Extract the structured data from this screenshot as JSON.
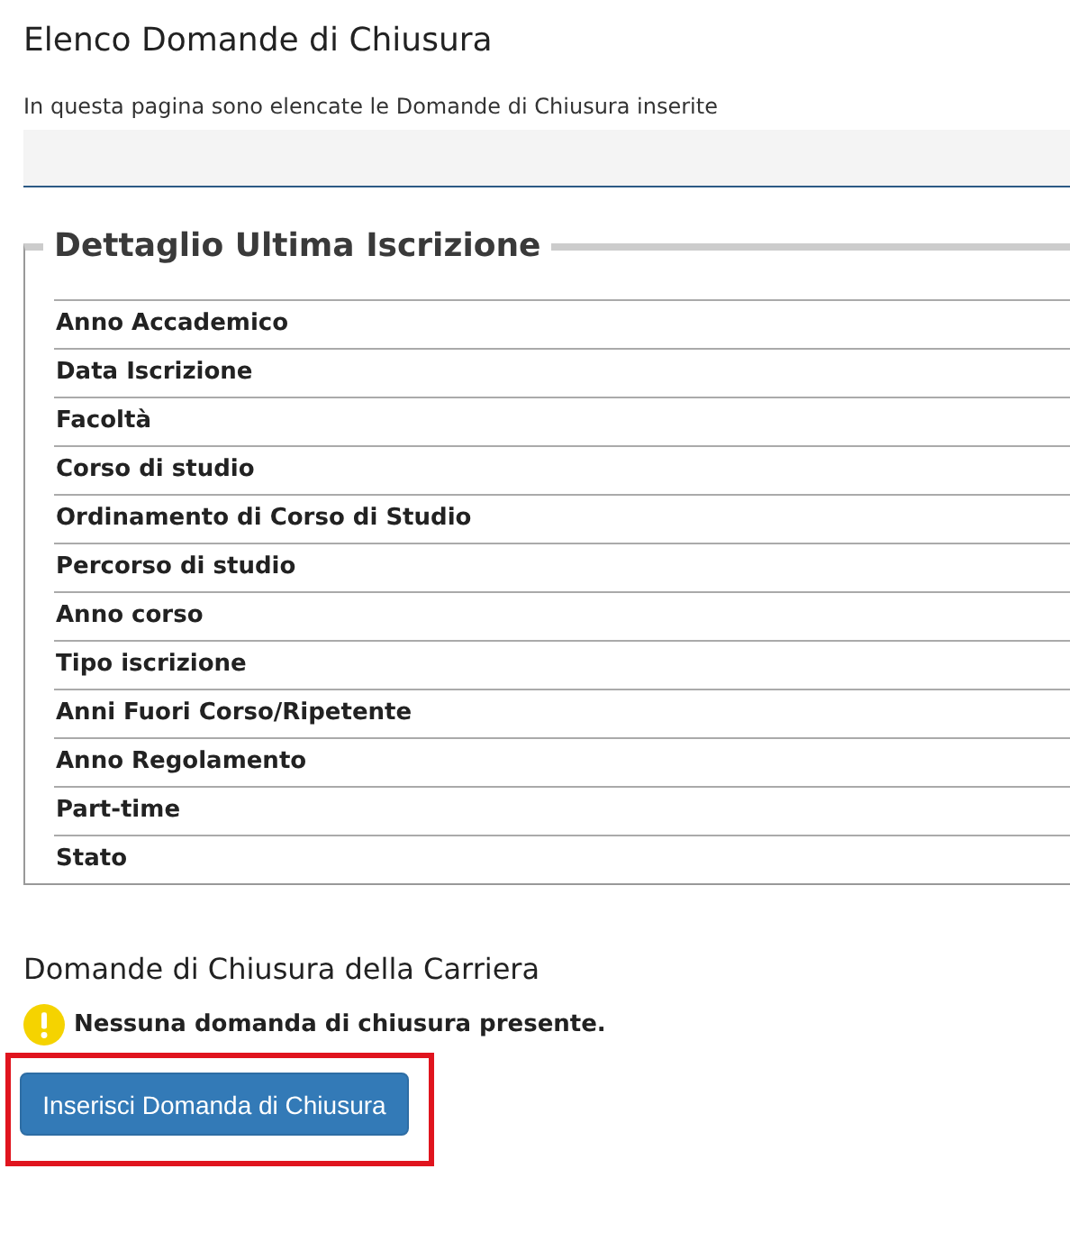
{
  "title": "Elenco Domande di Chiusura",
  "intro": "In questa pagina sono elencate le Domande di Chiusura inserite",
  "detail": {
    "legend": "Dettaglio Ultima Iscrizione",
    "rows": [
      "Anno Accademico",
      "Data Iscrizione",
      "Facoltà",
      "Corso di studio",
      "Ordinamento di Corso di Studio",
      "Percorso di studio",
      "Anno corso",
      "Tipo iscrizione",
      "Anni Fuori Corso/Ripetente",
      "Anno Regolamento",
      "Part-time",
      "Stato"
    ]
  },
  "section": {
    "title": "Domande di Chiusura della Carriera",
    "warning": "Nessuna domanda di chiusura presente.",
    "button": {
      "label": "Inserisci Domanda di Chiusura",
      "highlighted": true
    }
  }
}
